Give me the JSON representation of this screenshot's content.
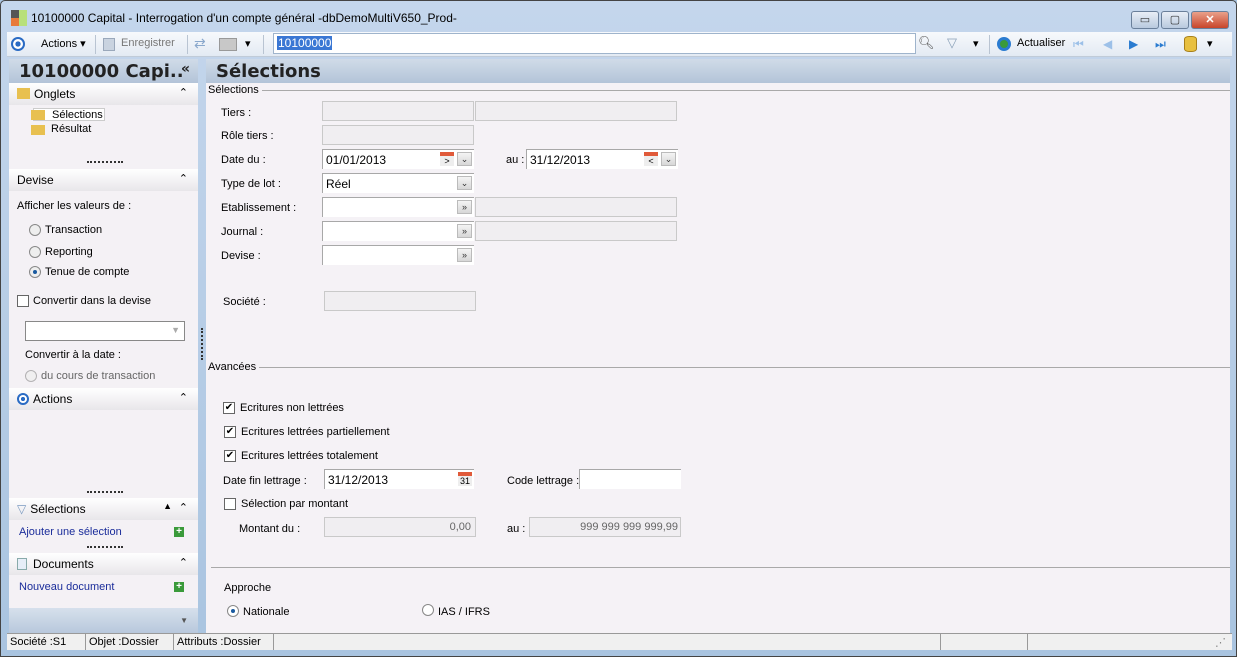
{
  "window": {
    "title": "10100000 Capital -  Interrogation d'un compte général -dbDemoMultiV650_Prod-",
    "minimize": "▭",
    "maximize": "▢",
    "close": "✕"
  },
  "toolbar": {
    "actions": "Actions",
    "save": "Enregistrer",
    "search_value": "10100000",
    "refresh": "Actualiser"
  },
  "left": {
    "title": "10100000 Capi..",
    "collapse": "«",
    "onglets": {
      "title": "Onglets",
      "items": [
        "Sélections",
        "Résultat"
      ]
    },
    "devise": {
      "title": "Devise",
      "afficher": "Afficher les valeurs de :",
      "options": [
        "Transaction",
        "Reporting",
        "Tenue de compte"
      ],
      "selected": "Tenue de compte",
      "convertir": "Convertir dans la devise",
      "convertir_date": "Convertir à la date :",
      "cours": "du cours de transaction"
    },
    "actions": {
      "title": "Actions"
    },
    "selections": {
      "title": "Sélections",
      "link": "Ajouter une sélection"
    },
    "documents": {
      "title": "Documents",
      "link": "Nouveau document"
    }
  },
  "main": {
    "title": "Sélections",
    "sel_group": "Sélections",
    "labels": {
      "tiers": "Tiers :",
      "role": "Rôle tiers :",
      "date_du": "Date du :",
      "au": "au :",
      "type_lot": "Type de lot :",
      "etab": "Etablissement :",
      "journal": "Journal :",
      "devise": "Devise :",
      "societe": "Société :"
    },
    "values": {
      "date_du": "01/01/2013",
      "date_au": "31/12/2013",
      "type_lot": "Réel"
    },
    "adv_group": "Avancées",
    "checks": [
      {
        "label": "Ecritures non lettrées",
        "checked": true
      },
      {
        "label": "Ecritures lettrées partiellement",
        "checked": true
      },
      {
        "label": "Ecritures lettrées totalement",
        "checked": true
      }
    ],
    "date_fin_label": "Date fin lettrage :",
    "date_fin": "31/12/2013",
    "cal_day": "31",
    "code_label": "Code lettrage :",
    "sel_montant": "Sélection par montant",
    "montant_du_label": "Montant du :",
    "montant_du": "0,00",
    "montant_au_label": "au :",
    "montant_au": "999 999 999 999,99",
    "approche": "Approche",
    "approche_options": [
      "Nationale",
      "IAS / IFRS"
    ],
    "approche_selected": "Nationale"
  },
  "status": {
    "societe": "Société :S1",
    "objet": "Objet :Dossier",
    "attributs": "Attributs :Dossier"
  }
}
